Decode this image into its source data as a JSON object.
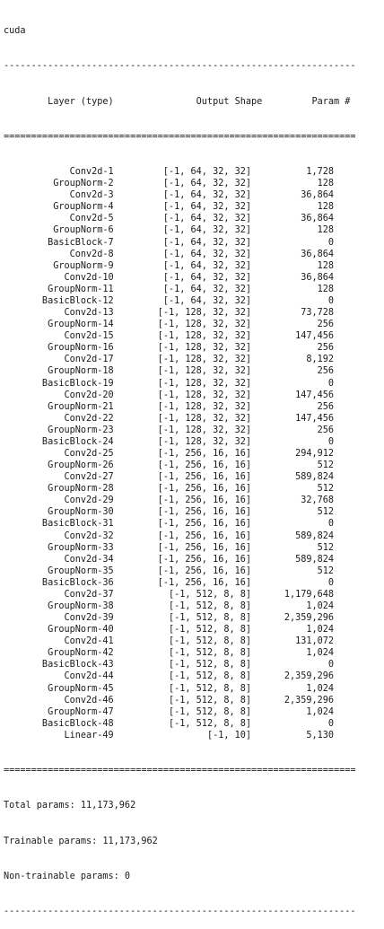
{
  "device": "cuda",
  "summary_header": "        Layer (type)               Output Shape         Param #",
  "rule_dash": "----------------------------------------------------------------",
  "rule_eq": "================================================================",
  "rows": [
    {
      "layer": "Conv2d-1",
      "shape": "[-1, 64, 32, 32]",
      "params": "1,728"
    },
    {
      "layer": "GroupNorm-2",
      "shape": "[-1, 64, 32, 32]",
      "params": "128"
    },
    {
      "layer": "Conv2d-3",
      "shape": "[-1, 64, 32, 32]",
      "params": "36,864"
    },
    {
      "layer": "GroupNorm-4",
      "shape": "[-1, 64, 32, 32]",
      "params": "128"
    },
    {
      "layer": "Conv2d-5",
      "shape": "[-1, 64, 32, 32]",
      "params": "36,864"
    },
    {
      "layer": "GroupNorm-6",
      "shape": "[-1, 64, 32, 32]",
      "params": "128"
    },
    {
      "layer": "BasicBlock-7",
      "shape": "[-1, 64, 32, 32]",
      "params": "0"
    },
    {
      "layer": "Conv2d-8",
      "shape": "[-1, 64, 32, 32]",
      "params": "36,864"
    },
    {
      "layer": "GroupNorm-9",
      "shape": "[-1, 64, 32, 32]",
      "params": "128"
    },
    {
      "layer": "Conv2d-10",
      "shape": "[-1, 64, 32, 32]",
      "params": "36,864"
    },
    {
      "layer": "GroupNorm-11",
      "shape": "[-1, 64, 32, 32]",
      "params": "128"
    },
    {
      "layer": "BasicBlock-12",
      "shape": "[-1, 64, 32, 32]",
      "params": "0"
    },
    {
      "layer": "Conv2d-13",
      "shape": "[-1, 128, 32, 32]",
      "params": "73,728"
    },
    {
      "layer": "GroupNorm-14",
      "shape": "[-1, 128, 32, 32]",
      "params": "256"
    },
    {
      "layer": "Conv2d-15",
      "shape": "[-1, 128, 32, 32]",
      "params": "147,456"
    },
    {
      "layer": "GroupNorm-16",
      "shape": "[-1, 128, 32, 32]",
      "params": "256"
    },
    {
      "layer": "Conv2d-17",
      "shape": "[-1, 128, 32, 32]",
      "params": "8,192"
    },
    {
      "layer": "GroupNorm-18",
      "shape": "[-1, 128, 32, 32]",
      "params": "256"
    },
    {
      "layer": "BasicBlock-19",
      "shape": "[-1, 128, 32, 32]",
      "params": "0"
    },
    {
      "layer": "Conv2d-20",
      "shape": "[-1, 128, 32, 32]",
      "params": "147,456"
    },
    {
      "layer": "GroupNorm-21",
      "shape": "[-1, 128, 32, 32]",
      "params": "256"
    },
    {
      "layer": "Conv2d-22",
      "shape": "[-1, 128, 32, 32]",
      "params": "147,456"
    },
    {
      "layer": "GroupNorm-23",
      "shape": "[-1, 128, 32, 32]",
      "params": "256"
    },
    {
      "layer": "BasicBlock-24",
      "shape": "[-1, 128, 32, 32]",
      "params": "0"
    },
    {
      "layer": "Conv2d-25",
      "shape": "[-1, 256, 16, 16]",
      "params": "294,912"
    },
    {
      "layer": "GroupNorm-26",
      "shape": "[-1, 256, 16, 16]",
      "params": "512"
    },
    {
      "layer": "Conv2d-27",
      "shape": "[-1, 256, 16, 16]",
      "params": "589,824"
    },
    {
      "layer": "GroupNorm-28",
      "shape": "[-1, 256, 16, 16]",
      "params": "512"
    },
    {
      "layer": "Conv2d-29",
      "shape": "[-1, 256, 16, 16]",
      "params": "32,768"
    },
    {
      "layer": "GroupNorm-30",
      "shape": "[-1, 256, 16, 16]",
      "params": "512"
    },
    {
      "layer": "BasicBlock-31",
      "shape": "[-1, 256, 16, 16]",
      "params": "0"
    },
    {
      "layer": "Conv2d-32",
      "shape": "[-1, 256, 16, 16]",
      "params": "589,824"
    },
    {
      "layer": "GroupNorm-33",
      "shape": "[-1, 256, 16, 16]",
      "params": "512"
    },
    {
      "layer": "Conv2d-34",
      "shape": "[-1, 256, 16, 16]",
      "params": "589,824"
    },
    {
      "layer": "GroupNorm-35",
      "shape": "[-1, 256, 16, 16]",
      "params": "512"
    },
    {
      "layer": "BasicBlock-36",
      "shape": "[-1, 256, 16, 16]",
      "params": "0"
    },
    {
      "layer": "Conv2d-37",
      "shape": "[-1, 512, 8, 8]",
      "params": "1,179,648"
    },
    {
      "layer": "GroupNorm-38",
      "shape": "[-1, 512, 8, 8]",
      "params": "1,024"
    },
    {
      "layer": "Conv2d-39",
      "shape": "[-1, 512, 8, 8]",
      "params": "2,359,296"
    },
    {
      "layer": "GroupNorm-40",
      "shape": "[-1, 512, 8, 8]",
      "params": "1,024"
    },
    {
      "layer": "Conv2d-41",
      "shape": "[-1, 512, 8, 8]",
      "params": "131,072"
    },
    {
      "layer": "GroupNorm-42",
      "shape": "[-1, 512, 8, 8]",
      "params": "1,024"
    },
    {
      "layer": "BasicBlock-43",
      "shape": "[-1, 512, 8, 8]",
      "params": "0"
    },
    {
      "layer": "Conv2d-44",
      "shape": "[-1, 512, 8, 8]",
      "params": "2,359,296"
    },
    {
      "layer": "GroupNorm-45",
      "shape": "[-1, 512, 8, 8]",
      "params": "1,024"
    },
    {
      "layer": "Conv2d-46",
      "shape": "[-1, 512, 8, 8]",
      "params": "2,359,296"
    },
    {
      "layer": "GroupNorm-47",
      "shape": "[-1, 512, 8, 8]",
      "params": "1,024"
    },
    {
      "layer": "BasicBlock-48",
      "shape": "[-1, 512, 8, 8]",
      "params": "0"
    },
    {
      "layer": "Linear-49",
      "shape": "[-1, 10]",
      "params": "5,130"
    }
  ],
  "totals": {
    "total": "Total params: 11,173,962",
    "trainable": "Trainable params: 11,173,962",
    "non_trainable": "Non-trainable params: 0"
  }
}
